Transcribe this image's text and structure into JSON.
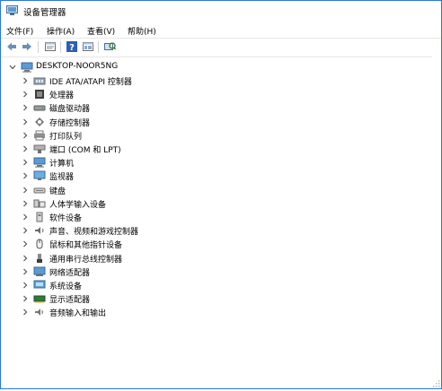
{
  "window": {
    "title": "设备管理器",
    "accent_color": "#2b78d8"
  },
  "menu": [
    {
      "label": "文件(F)"
    },
    {
      "label": "操作(A)"
    },
    {
      "label": "查看(V)"
    },
    {
      "label": "帮助(H)"
    }
  ],
  "toolbar": {
    "buttons": [
      "back-icon",
      "forward-icon",
      "properties-icon",
      "help-icon",
      "view-icon",
      "scan-hardware-icon"
    ]
  },
  "tree": {
    "root": {
      "label": "DESKTOP-NOOR5NG",
      "icon": "computer-icon",
      "expanded": true
    },
    "items": [
      {
        "label": "IDE ATA/ATAPI 控制器",
        "icon": "ide-controller-icon"
      },
      {
        "label": "处理器",
        "icon": "processor-icon"
      },
      {
        "label": "磁盘驱动器",
        "icon": "disk-drive-icon"
      },
      {
        "label": "存储控制器",
        "icon": "storage-controller-icon"
      },
      {
        "label": "打印队列",
        "icon": "print-queue-icon"
      },
      {
        "label": "端口 (COM 和 LPT)",
        "icon": "port-icon"
      },
      {
        "label": "计算机",
        "icon": "computer-icon"
      },
      {
        "label": "监视器",
        "icon": "monitor-icon"
      },
      {
        "label": "键盘",
        "icon": "keyboard-icon"
      },
      {
        "label": "人体学输入设备",
        "icon": "hid-icon"
      },
      {
        "label": "软件设备",
        "icon": "software-device-icon"
      },
      {
        "label": "声音、视频和游戏控制器",
        "icon": "sound-icon"
      },
      {
        "label": "鼠标和其他指针设备",
        "icon": "mouse-icon"
      },
      {
        "label": "通用串行总线控制器",
        "icon": "usb-icon"
      },
      {
        "label": "网络适配器",
        "icon": "network-adapter-icon"
      },
      {
        "label": "系统设备",
        "icon": "system-device-icon"
      },
      {
        "label": "显示适配器",
        "icon": "display-adapter-icon"
      },
      {
        "label": "音频输入和输出",
        "icon": "audio-io-icon"
      }
    ]
  }
}
